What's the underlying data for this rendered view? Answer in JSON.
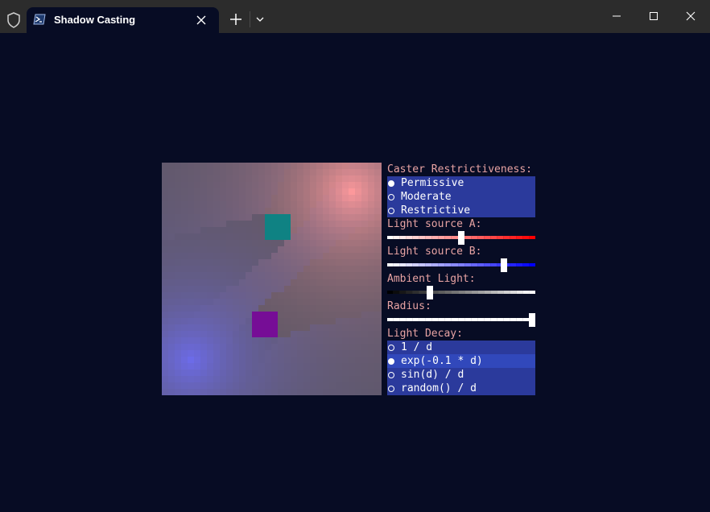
{
  "window": {
    "tab_title": "Shadow Casting",
    "tab_icon": "powershell-icon",
    "shield_icon": "shield-icon",
    "controls": [
      "minimize-icon",
      "maximize-icon",
      "close-icon"
    ]
  },
  "scene": {
    "light_a": {
      "color": "#ff9999",
      "col": 29,
      "row": 4
    },
    "light_b": {
      "color": "#6f6fff",
      "col": 4,
      "row": 30
    },
    "casters": [
      {
        "name": "cyan-caster",
        "color": "#008a8a",
        "col": 16,
        "row": 8,
        "size": 4
      },
      {
        "name": "purple-caster",
        "color": "#7a00a0",
        "col": 14,
        "row": 23,
        "size": 4
      }
    ],
    "grid": {
      "cols": 34,
      "rows": 36
    }
  },
  "panel": {
    "restrictiveness": {
      "label": "Caster Restrictiveness:",
      "options": [
        "Permissive",
        "Moderate",
        "Restrictive"
      ],
      "selected": 0
    },
    "light_a": {
      "label": "Light source A:",
      "value": 0.5,
      "from": "#ffffff",
      "to": "#ff0000"
    },
    "light_b": {
      "label": "Light source B:",
      "value": 0.8,
      "from": "#ffffff",
      "to": "#0000ff"
    },
    "ambient": {
      "label": "Ambient Light:",
      "value": 0.28,
      "from": "#000000",
      "to": "#ffffff"
    },
    "radius": {
      "label": "Radius:",
      "value": 1.0,
      "from": "#ffffff",
      "to": "#ffffff"
    },
    "decay": {
      "label": "Light Decay:",
      "options": [
        "1 / d",
        "exp(-0.1 * d)",
        "sin(d) / d",
        "random() / d"
      ],
      "selected": 1
    }
  }
}
